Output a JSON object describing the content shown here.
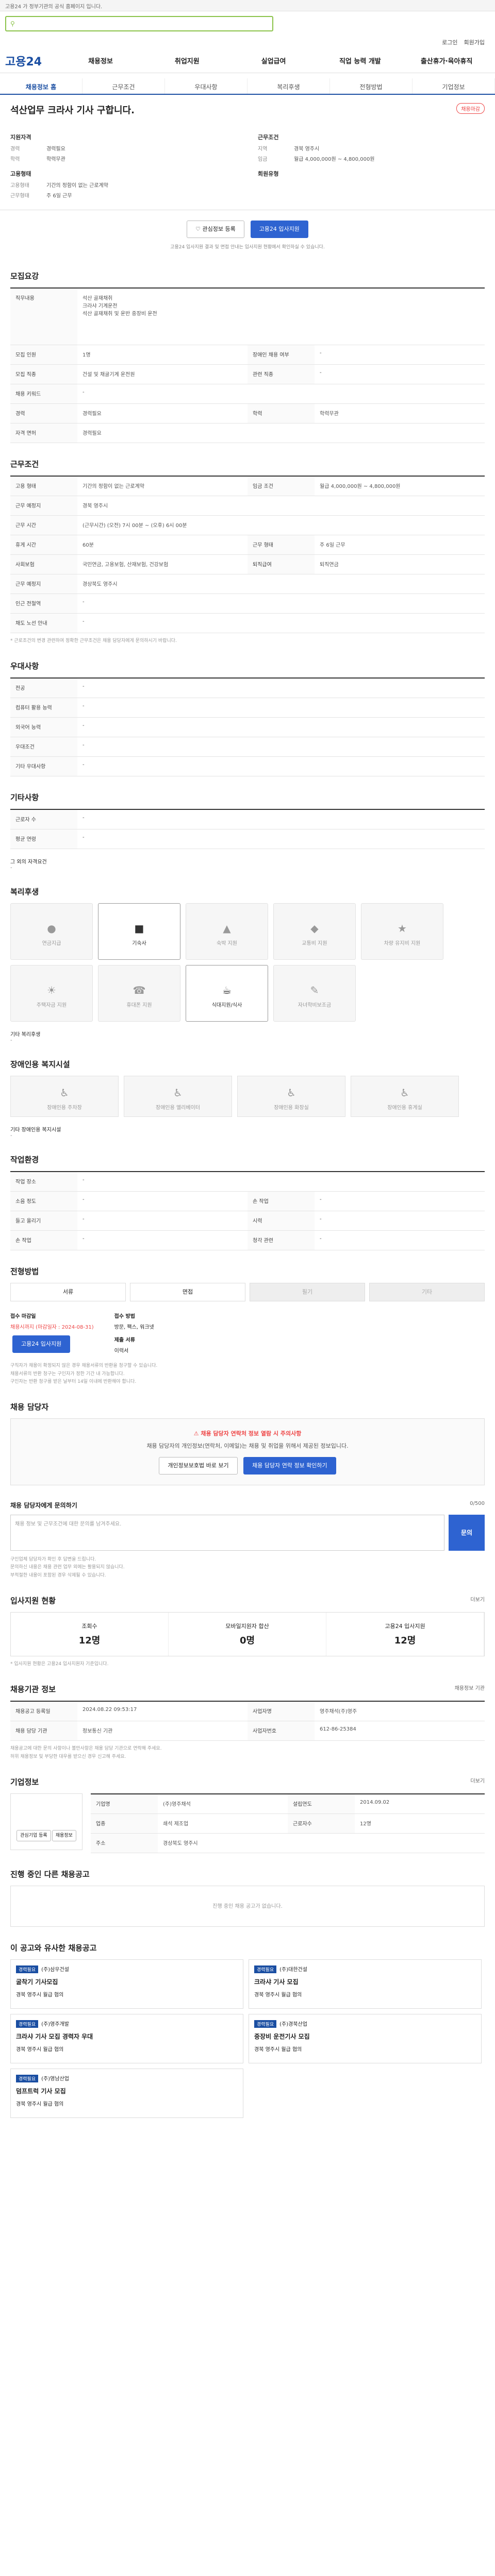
{
  "top_msg": "고용24 가 정부기관의 공식 홈페이지 입니다.",
  "search": {
    "btn": "검색"
  },
  "util": [
    "로그인",
    "회원가입"
  ],
  "gnb": {
    "logo": "고용24",
    "items": [
      "채용정보",
      "취업지원",
      "실업급여",
      "직업 능력 개발",
      "출산휴가·육아휴직"
    ]
  },
  "tabs": [
    "채용정보 홈",
    "근무조건",
    "우대사항",
    "복리후생",
    "전형방법",
    "기업정보"
  ],
  "head": {
    "title": "석산업무 크라사 기사 구합니다.",
    "badge": "채용마감",
    "col1_title": "지원자격",
    "career_lbl": "경력",
    "career_val": "경력필요",
    "edu_lbl": "학력",
    "edu_val": "학력무관",
    "col2_title": "근무조건",
    "area_lbl": "지역",
    "area_val": "경북 영주시",
    "pay_lbl": "임금",
    "pay_val": "월급 4,000,000원 ~ 4,800,000원",
    "type_lbl": "고용형태",
    "type_val": "기간의 정함이 없는 근로계약",
    "hours_lbl": "근무형태",
    "hours_val": "주 6일 근무",
    "etc_title": "고용형태",
    "etc_title2": "회원유형"
  },
  "buttons": {
    "scrap": "관심정보 등록",
    "apply": "고용24 입사지원"
  },
  "head_note": "고용24 입사지원 결과 및 면접 안내는 입사지원 현황에서 확인하실 수 있습니다.",
  "detail": {
    "title": "모집요강",
    "job_title": "직무내용",
    "job_text": [
      "석산 골재채취",
      "크라샤 기계운전",
      "석산 골재채취 및 운반 중장비 운전"
    ],
    "rows": [
      [
        "모집 인원",
        "1명",
        "장애인 채용 여부",
        "-"
      ],
      [
        "모집 직종",
        "건설 및 채굴기계 운전원",
        "관련 직종",
        "-"
      ],
      [
        "채용 키워드",
        "-",
        "",
        ""
      ],
      [
        "경력",
        "경력필요",
        "학력",
        "학력무관"
      ],
      [
        "자격 면허",
        "경력필요",
        "",
        ""
      ]
    ]
  },
  "cond": {
    "title": "근무조건",
    "rows": [
      [
        "고용 형태",
        "기간의 정함이 없는 근로계약",
        "임금 조건",
        "월급 4,000,000원 ~ 4,800,000원"
      ],
      [
        "근무 예정지",
        "경북 영주시",
        "",
        ""
      ],
      [
        "근무 시간",
        "(근무시간) (오전) 7시 00분 ~ (오후) 6시 00분",
        "",
        ""
      ],
      [
        "휴게 시간",
        "60분",
        "근무 형태",
        "주 6일 근무"
      ],
      [
        "사회보험",
        "국민연금, 고용보험, 산재보험, 건강보험",
        "퇴직급여",
        "퇴직연금"
      ],
      [
        "근무 예정지",
        "경상북도 영주시",
        "",
        ""
      ],
      [
        "인근 전철역",
        "-",
        "",
        ""
      ],
      [
        "채도 노선 안내",
        "-",
        "",
        ""
      ]
    ],
    "note": "* 근로조건의 변경 관련하여 정확한 근무조건은 채용 담당자에게 문의하시기 바랍니다."
  },
  "pref": {
    "title": "우대사항",
    "rows": [
      [
        "전공",
        "-"
      ],
      [
        "컴퓨터 활용 능력",
        "-"
      ],
      [
        "외국어 능력",
        "-"
      ],
      [
        "우대조건",
        "-"
      ],
      [
        "기타 우대사항",
        "-"
      ]
    ]
  },
  "etc": {
    "title": "기타사항",
    "rows": [
      [
        "근로자 수",
        "-"
      ],
      [
        "평균 연령",
        "-"
      ]
    ]
  },
  "etc_extra": {
    "label": "그 외의 자격요건",
    "val": "-"
  },
  "welfare": {
    "title": "복리후생",
    "items": [
      "연금지급",
      "기숙사",
      "숙박 지원",
      "교통비 지원",
      "차량 유지비 지원",
      "주택자금 지원",
      "휴대폰 지원",
      "식대지원/식사",
      "자녀학비보조금"
    ],
    "extra_lbl": "기타 복리후생",
    "extra_val": "-"
  },
  "access": {
    "title": "장애인용 복지시설",
    "items": [
      "장애인용 주차장",
      "장애인용 엘리베이터",
      "장애인용 화장실",
      "장애인용 휴게실"
    ],
    "extra_lbl": "기타 장애인용 복지시설",
    "extra_val": "-"
  },
  "work": {
    "title": "작업환경",
    "rows": [
      [
        "작업 장소",
        "-",
        "",
        ""
      ],
      [
        "소음 정도",
        "-",
        "손 작업",
        "-"
      ],
      [
        "들고 올리기",
        "-",
        "시력",
        "-"
      ],
      [
        "손 작업",
        "-",
        "청각 관련",
        "-"
      ]
    ]
  },
  "proc": {
    "title": "전형방법",
    "steps": [
      "서류",
      "면접",
      "필기",
      "기타"
    ],
    "deadline_lbl": "접수 마감일",
    "deadline_val": "채용시까지 (마감일자 : 2024-08-31)",
    "method_lbl": "접수 방법",
    "method_val": "방문, 팩스, 워크넷",
    "docs_lbl": "제출 서류",
    "docs_val": "이력서",
    "apply": "고용24 입사지원",
    "notes": [
      "구직자가 채용이 확정되지 않은 경우 채용서류의 반환을 청구할 수 있습니다.",
      "채용서류의 반환 청구는 구인자가 정한 기간 내 가능합니다.",
      "구인자는 반환 청구를 받은 날부터 14일 이내에 반환해야 합니다."
    ]
  },
  "contact": {
    "title": "채용 담당자",
    "notice": "채용 담당자 연락처 정보 열람 시 주의사항",
    "desc": "채용 담당자의 개인정보(연락처, 이메일)는 채용 및 취업을 위해서 제공된 정보입니다.",
    "btn1": "개인정보보호법 바로 보기",
    "btn2": "채용 담당자 연락 정보 확인하기"
  },
  "qa": {
    "title": "채용 담당자에게 문의하기",
    "count": "0/500",
    "placeholder": "채용 정보 및 근무조건에 대한 문의를 남겨주세요.",
    "btn": "문의",
    "notes": [
      "구인업체 담당자가 확인 후 답변을 드립니다.",
      "문의하신 내용은 채용 관련 업무 외에는 활용되지 않습니다.",
      "부적절한 내용이 포함된 경우 삭제될 수 있습니다."
    ]
  },
  "stats": {
    "title": "입사지원 현황",
    "more": "더보기",
    "items": [
      {
        "label": "조회수",
        "val": "12명"
      },
      {
        "label": "모바일지원자 합산",
        "val": "0명"
      },
      {
        "label": "고용24 입사지원",
        "val": "12명"
      }
    ],
    "note": "* 입사지원 현황은 고용24 입사지원자 기준입니다."
  },
  "info": {
    "title": "채용기관 정보",
    "link": "채용정보 기관",
    "rows": [
      [
        "채용공고 등록일",
        "2024.08.22 09:53:17",
        "사업자명",
        "영주채석(주)영주"
      ],
      [
        "채용 담당 기관",
        "정보통신 기관",
        "사업자번호",
        "612-86-25384"
      ]
    ],
    "notes": [
      "채용공고에 대한 문의 사항이나 불만사항은 채용 담당 기관으로 연락해 주세요.",
      "허위 채용정보 및 부당한 대우를 받으신 경우 신고해 주세요."
    ]
  },
  "company": {
    "title": "기업정보",
    "more": "더보기",
    "rows": [
      [
        "기업명",
        "(주)영주채석",
        "설립연도",
        "2014.09.02"
      ],
      [
        "업종",
        "쇄석 제조업",
        "근로자수",
        "12명"
      ],
      [
        "주소",
        "경상북도 영주시",
        "",
        ""
      ]
    ],
    "btn1": "관심기업 등록",
    "btn2": "채용정보"
  },
  "other": {
    "title": "진행 중인 다른 채용공고",
    "empty": "진행 중인 채용 공고가 없습니다."
  },
  "recommend": {
    "title": "이 공고와 유사한 채용공고",
    "items": [
      {
        "tag": "경력필요",
        "company": "(주)삼우건설",
        "title": "굴착기 기사모집",
        "loc": "경북 영주시",
        "pay": "월급 협의"
      },
      {
        "tag": "경력필요",
        "company": "(주)대한건설",
        "title": "크라샤 기사 모집",
        "loc": "경북 영주시",
        "pay": "월급 협의"
      },
      {
        "tag": "경력필요",
        "company": "(주)영주개발",
        "title": "크라샤 기사 모집 경력자 우대",
        "loc": "경북 영주시",
        "pay": "월급 협의"
      },
      {
        "tag": "경력필요",
        "company": "(주)경북산업",
        "title": "중장비 운전기사 모집",
        "loc": "경북 영주시",
        "pay": "월급 협의"
      },
      {
        "tag": "경력필요",
        "company": "(주)영남산업",
        "title": "덤프트럭 기사 모집",
        "loc": "경북 영주시",
        "pay": "월급 협의"
      }
    ]
  }
}
